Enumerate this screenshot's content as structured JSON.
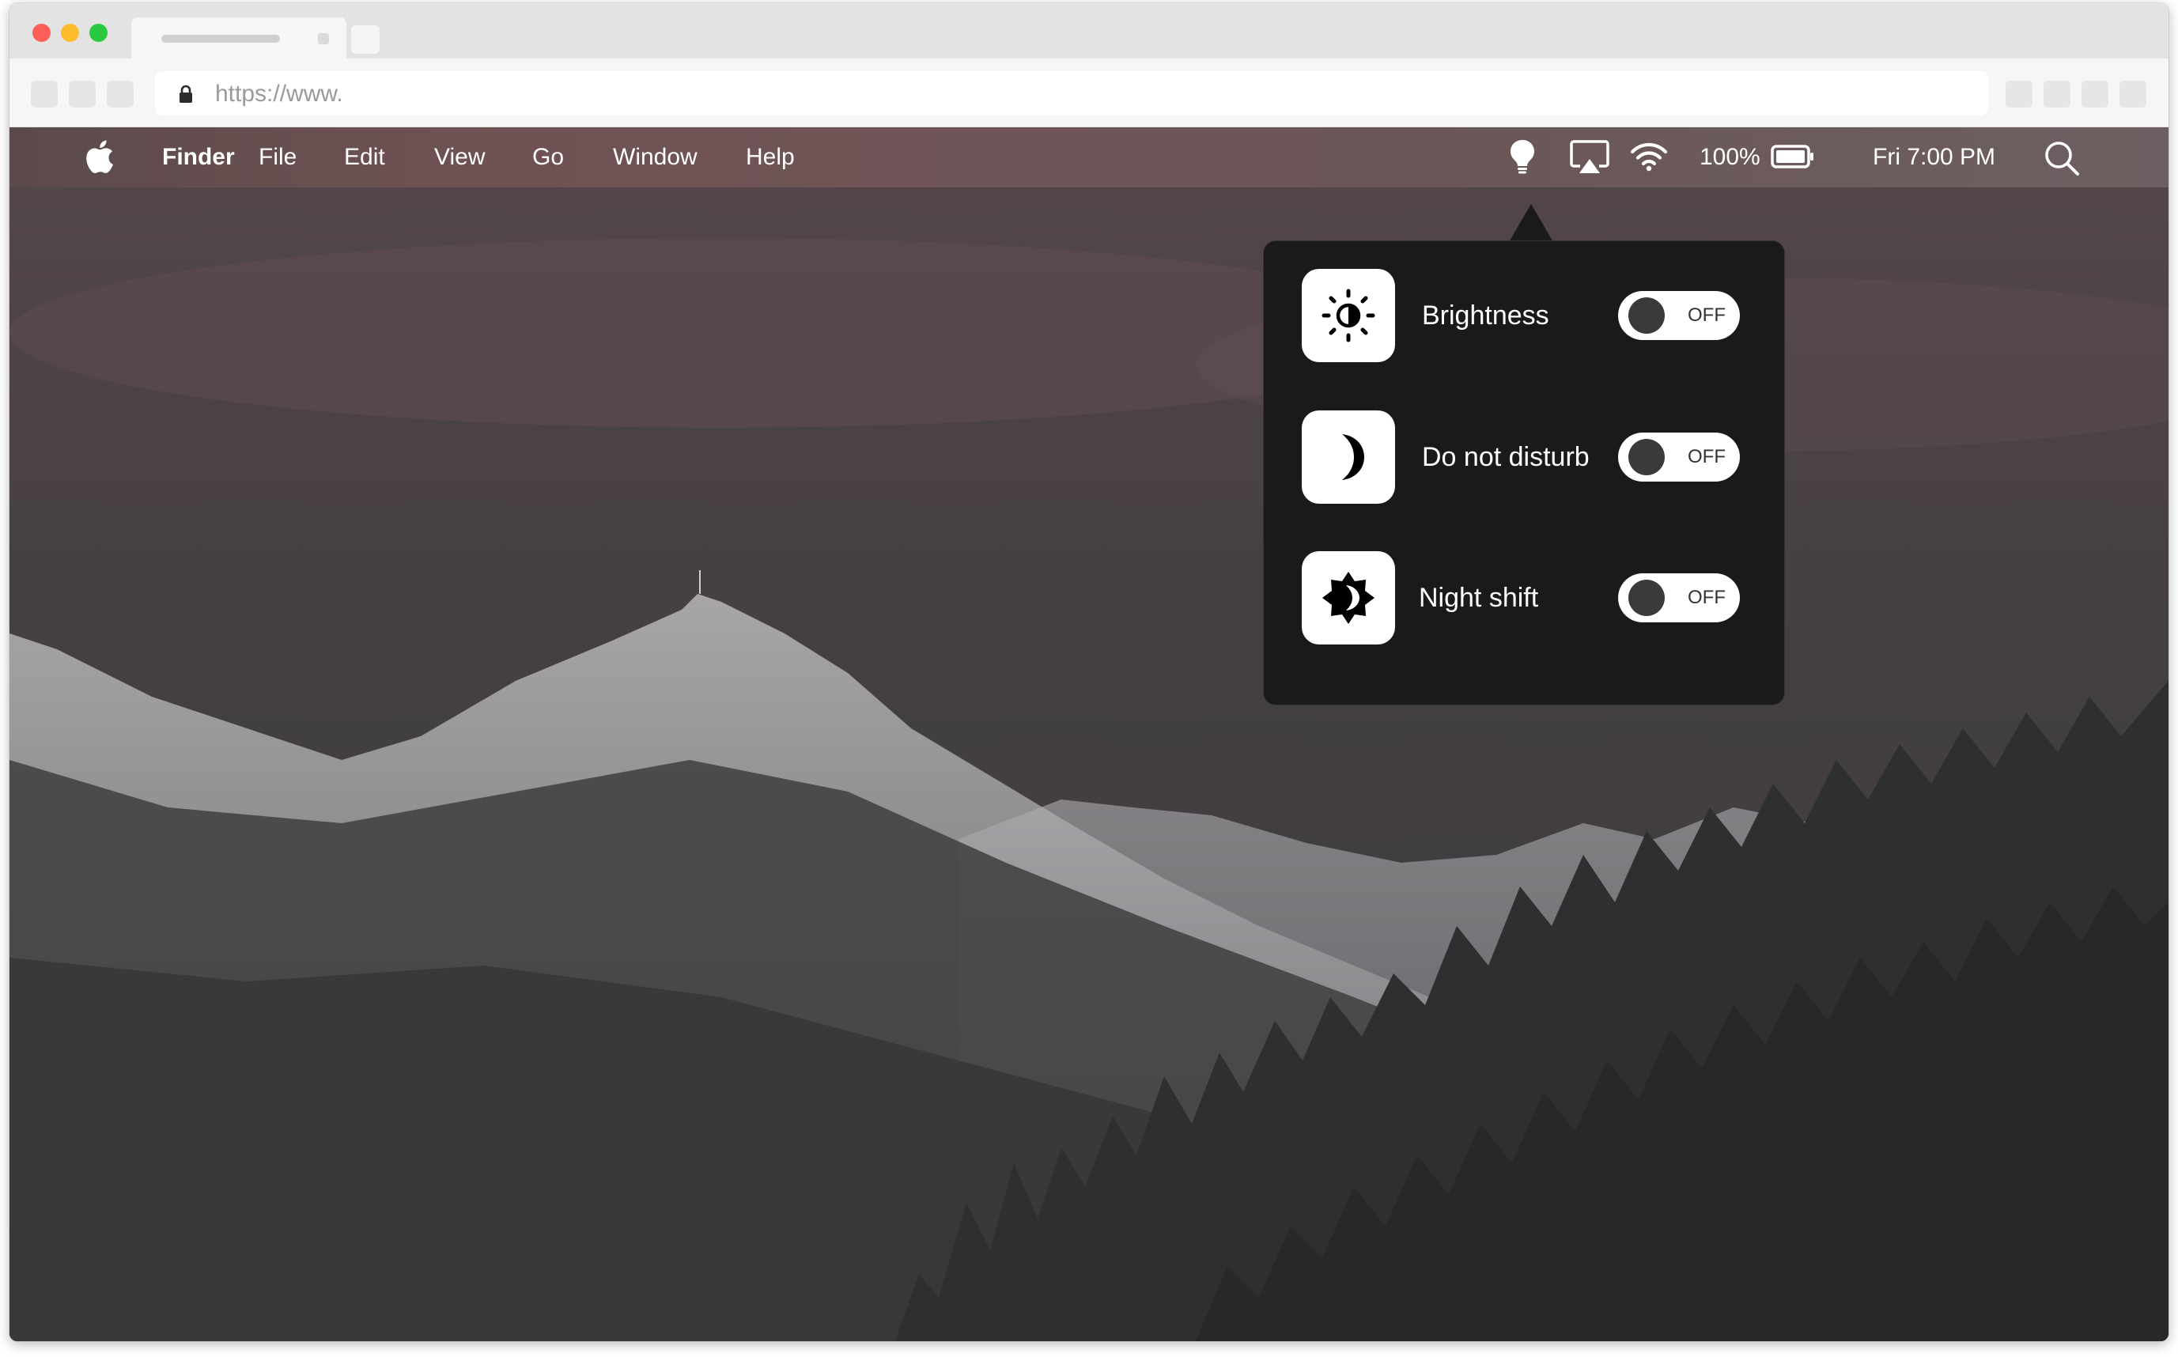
{
  "browser": {
    "url": "https://www."
  },
  "menubar": {
    "app_name": "Finder",
    "items": [
      "File",
      "Edit",
      "View",
      "Go",
      "Window",
      "Help"
    ],
    "battery": "100%",
    "clock": "Fri 7:00 PM",
    "status_icons": [
      "lightbulb-icon",
      "airplay-icon",
      "wifi-icon",
      "battery-icon",
      "search-icon"
    ]
  },
  "popover": {
    "rows": [
      {
        "label": "Brightness",
        "icon": "brightness-icon",
        "toggle": "OFF"
      },
      {
        "label": "Do not disturb",
        "icon": "moon-icon",
        "toggle": "OFF"
      },
      {
        "label": "Night shift",
        "icon": "night-shift-icon",
        "toggle": "OFF"
      }
    ]
  },
  "colors": {
    "traffic_red": "#fc5f57",
    "traffic_yellow": "#fdbc2e",
    "traffic_green": "#29c940",
    "popover_bg": "#1a1a1a",
    "toggle_bg": "#ffffff"
  }
}
